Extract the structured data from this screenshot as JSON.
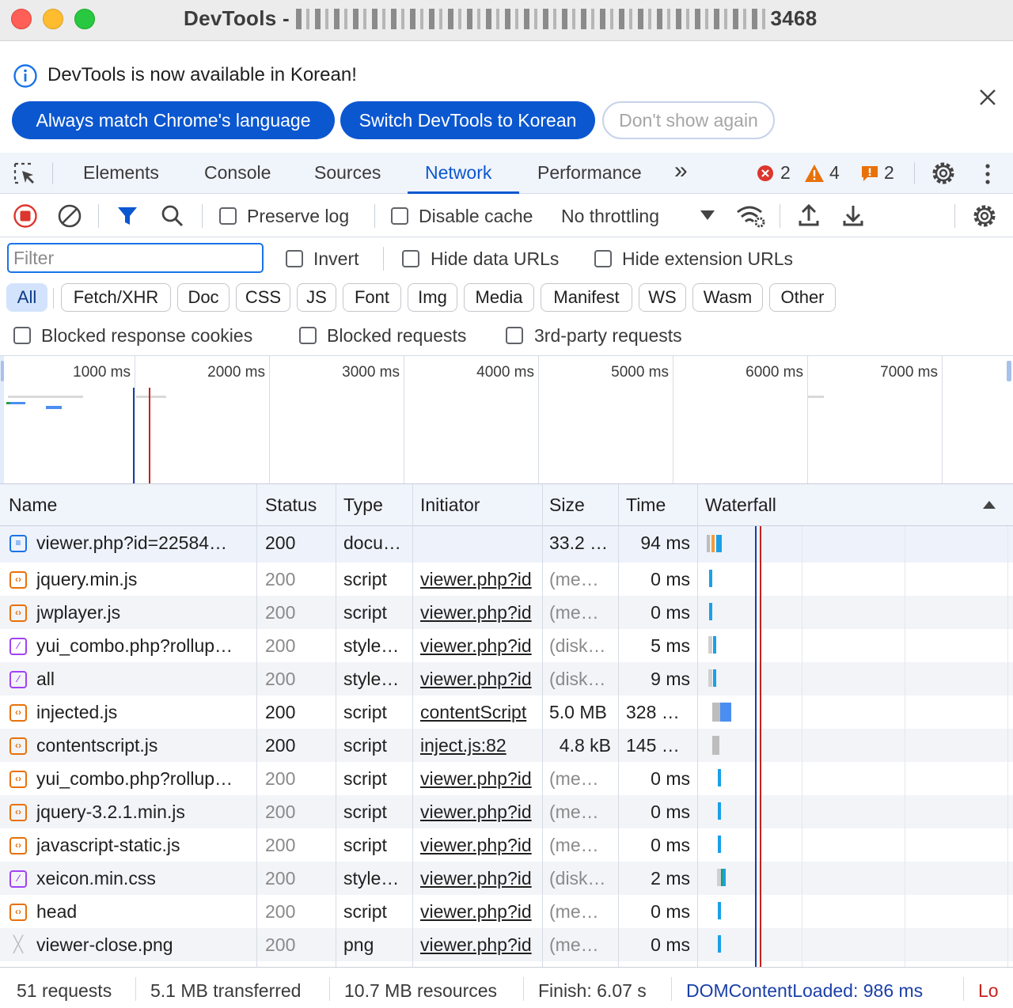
{
  "window": {
    "title_prefix": "DevTools - ",
    "title_suffix": "3468"
  },
  "infobar": {
    "message": "DevTools is now available in Korean!",
    "buttons": {
      "match": "Always match Chrome's language",
      "switch": "Switch DevTools to Korean",
      "dismiss": "Don't show again"
    }
  },
  "tabs": {
    "items": [
      "Elements",
      "Console",
      "Sources",
      "Network",
      "Performance"
    ],
    "active": "Network",
    "more": "»",
    "errors": "2",
    "warnings": "4",
    "issues": "2"
  },
  "toolbar": {
    "preserve_log": "Preserve log",
    "disable_cache": "Disable cache",
    "throttling": "No throttling"
  },
  "filters": {
    "placeholder": "Filter",
    "invert": "Invert",
    "hide_data_urls": "Hide data URLs",
    "hide_extension_urls": "Hide extension URLs",
    "types": [
      "All",
      "Fetch/XHR",
      "Doc",
      "CSS",
      "JS",
      "Font",
      "Img",
      "Media",
      "Manifest",
      "WS",
      "Wasm",
      "Other"
    ],
    "active_type": "All",
    "blocked_cookies": "Blocked response cookies",
    "blocked_requests": "Blocked requests",
    "third_party": "3rd-party requests"
  },
  "overview": {
    "ticks": [
      "1000 ms",
      "2000 ms",
      "3000 ms",
      "4000 ms",
      "5000 ms",
      "6000 ms",
      "7000 ms"
    ]
  },
  "table": {
    "columns": [
      "Name",
      "Status",
      "Type",
      "Initiator",
      "Size",
      "Time",
      "Waterfall"
    ],
    "rows": [
      {
        "name": "viewer.php?id=22584…",
        "status": "200",
        "type": "docu…",
        "initiator": "",
        "size": "33.2 …",
        "time": "94 ms",
        "kind": "doc"
      },
      {
        "name": "jquery.min.js",
        "status": "200",
        "type": "script",
        "initiator": "viewer.php?id",
        "size": "(me…",
        "time": "0 ms",
        "kind": "script"
      },
      {
        "name": "jwplayer.js",
        "status": "200",
        "type": "script",
        "initiator": "viewer.php?id",
        "size": "(me…",
        "time": "0 ms",
        "kind": "script"
      },
      {
        "name": "yui_combo.php?rollup…",
        "status": "200",
        "type": "style…",
        "initiator": "viewer.php?id",
        "size": "(disk…",
        "time": "5 ms",
        "kind": "style"
      },
      {
        "name": "all",
        "status": "200",
        "type": "style…",
        "initiator": "viewer.php?id",
        "size": "(disk…",
        "time": "9 ms",
        "kind": "style"
      },
      {
        "name": "injected.js",
        "status": "200",
        "type": "script",
        "initiator": "contentScript",
        "size": "5.0 MB",
        "time": "328 …",
        "kind": "script"
      },
      {
        "name": "contentscript.js",
        "status": "200",
        "type": "script",
        "initiator": "inject.js:82",
        "size": "4.8 kB",
        "time": "145 …",
        "kind": "script"
      },
      {
        "name": "yui_combo.php?rollup…",
        "status": "200",
        "type": "script",
        "initiator": "viewer.php?id",
        "size": "(me…",
        "time": "0 ms",
        "kind": "script"
      },
      {
        "name": "jquery-3.2.1.min.js",
        "status": "200",
        "type": "script",
        "initiator": "viewer.php?id",
        "size": "(me…",
        "time": "0 ms",
        "kind": "script"
      },
      {
        "name": "javascript-static.js",
        "status": "200",
        "type": "script",
        "initiator": "viewer.php?id",
        "size": "(me…",
        "time": "0 ms",
        "kind": "script"
      },
      {
        "name": "xeicon.min.css",
        "status": "200",
        "type": "style…",
        "initiator": "viewer.php?id",
        "size": "(disk…",
        "time": "2 ms",
        "kind": "style"
      },
      {
        "name": "head",
        "status": "200",
        "type": "script",
        "initiator": "viewer.php?id",
        "size": "(me…",
        "time": "0 ms",
        "kind": "script"
      },
      {
        "name": "viewer-close.png",
        "status": "200",
        "type": "png",
        "initiator": "viewer.php?id",
        "size": "(me…",
        "time": "0 ms",
        "kind": "img"
      }
    ]
  },
  "statusbar": {
    "requests": "51 requests",
    "transferred": "5.1 MB transferred",
    "resources": "10.7 MB resources",
    "finish": "Finish: 6.07 s",
    "dcl": "DOMContentLoaded: 986 ms",
    "load": "Lo"
  },
  "colors": {
    "accent": "#0b57d0",
    "error": "#dc362e",
    "warning": "#e8710a",
    "dcl_line": "#1a3fa8",
    "load_line": "#c5221f"
  }
}
